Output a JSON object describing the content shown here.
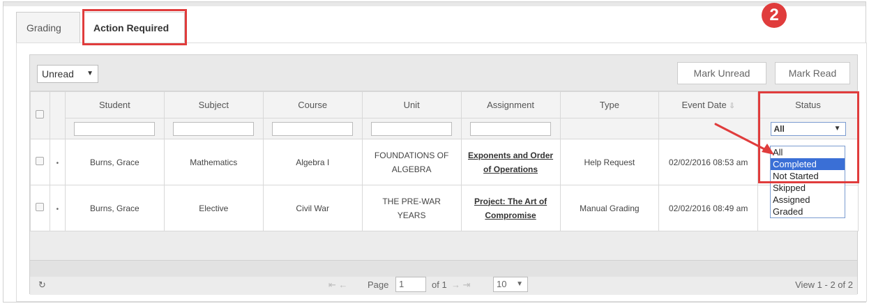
{
  "tabs": [
    {
      "label": "Grading"
    },
    {
      "label": "Action Required"
    }
  ],
  "toolbar": {
    "filter_value": "Unread",
    "mark_unread_label": "Mark Unread",
    "mark_read_label": "Mark Read",
    "step_badge": "2"
  },
  "table": {
    "headers": [
      "Student",
      "Subject",
      "Course",
      "Unit",
      "Assignment",
      "Type",
      "Event Date",
      "Status"
    ],
    "sort_indicator": "⇩",
    "status_filter_value": "All",
    "rows": [
      {
        "student": "Burns, Grace",
        "subject": "Mathematics",
        "course": "Algebra I",
        "unit": "FOUNDATIONS OF ALGEBRA",
        "assignment": "Exponents and Order of Operations",
        "type": "Help Request",
        "event_date": "02/02/2016 08:53 am"
      },
      {
        "student": "Burns, Grace",
        "subject": "Elective",
        "course": "Civil War",
        "unit": "THE PRE-WAR YEARS",
        "assignment": "Project: The Art of Compromise",
        "type": "Manual Grading",
        "event_date": "02/02/2016 08:49 am"
      }
    ]
  },
  "status_dropdown": {
    "options": [
      "All",
      "Completed",
      "Not Started",
      "Skipped",
      "Assigned",
      "Graded"
    ],
    "highlighted": "Completed"
  },
  "pager": {
    "page_label": "Page",
    "page_value": "1",
    "of_label": "of 1",
    "rows_per_page": "10",
    "view_label": "View 1 - 2 of 2"
  },
  "colors": {
    "highlight": "#e03c3c",
    "selected_option": "#3a6fd6"
  }
}
